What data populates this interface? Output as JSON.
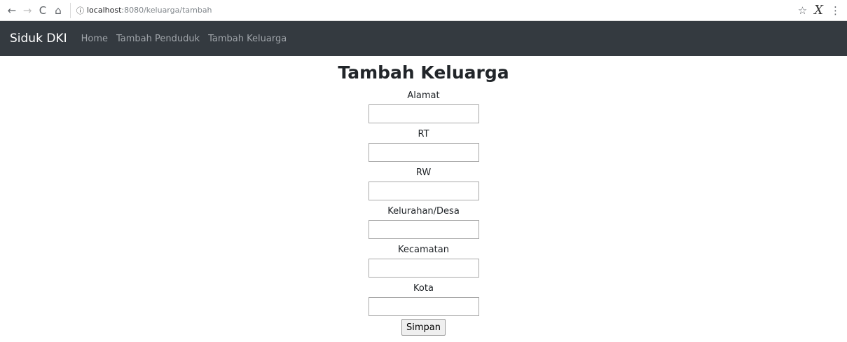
{
  "browser": {
    "back_icon": "←",
    "forward_icon": "→",
    "reload_icon": "C",
    "home_icon": "⌂",
    "info_icon": "ⓘ",
    "url_host": "localhost",
    "url_rest": ":8080/keluarga/tambah",
    "star_icon": "☆",
    "extension_icon": "X",
    "menu_icon": "⋮"
  },
  "navbar": {
    "brand": "Siduk DKI",
    "links": [
      "Home",
      "Tambah Penduduk",
      "Tambah Keluarga"
    ],
    "background": "#343a40"
  },
  "form": {
    "title": "Tambah Keluarga",
    "fields": [
      {
        "label": "Alamat",
        "value": ""
      },
      {
        "label": "RT",
        "value": ""
      },
      {
        "label": "RW",
        "value": ""
      },
      {
        "label": "Kelurahan/Desa",
        "value": ""
      },
      {
        "label": "Kecamatan",
        "value": ""
      },
      {
        "label": "Kota",
        "value": ""
      }
    ],
    "submit_label": "Simpan"
  }
}
